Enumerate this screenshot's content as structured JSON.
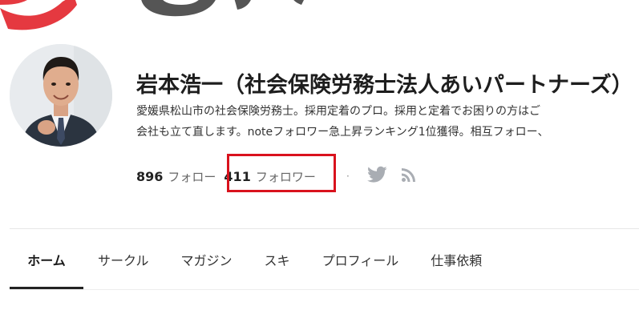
{
  "profile": {
    "name": "岩本浩一（社会保険労務士法人あいパートナーズ）",
    "bio_line1": "愛媛県松山市の社会保険労務士。採用定着のプロ。採用と定着でお困りの方はご",
    "bio_line2": "会社も立て直します。noteフォロワー急上昇ランキング1位獲得。相互フォロー、",
    "avatar_icon": "profile-photo"
  },
  "stats": {
    "following_count": "896",
    "following_label": "フォロー",
    "followers_count": "411",
    "followers_label": "フォロワー",
    "separator": "·",
    "highlight_color": "#d9121d"
  },
  "social": {
    "twitter_icon": "twitter-icon",
    "rss_icon": "rss-icon"
  },
  "tabs": [
    {
      "label": "ホーム",
      "active": true
    },
    {
      "label": "サークル",
      "active": false
    },
    {
      "label": "マガジン",
      "active": false
    },
    {
      "label": "スキ",
      "active": false
    },
    {
      "label": "プロフィール",
      "active": false
    },
    {
      "label": "仕事依頼",
      "active": false
    }
  ],
  "colors": {
    "accent_red": "#e53940",
    "cover_dark": "#555555"
  }
}
